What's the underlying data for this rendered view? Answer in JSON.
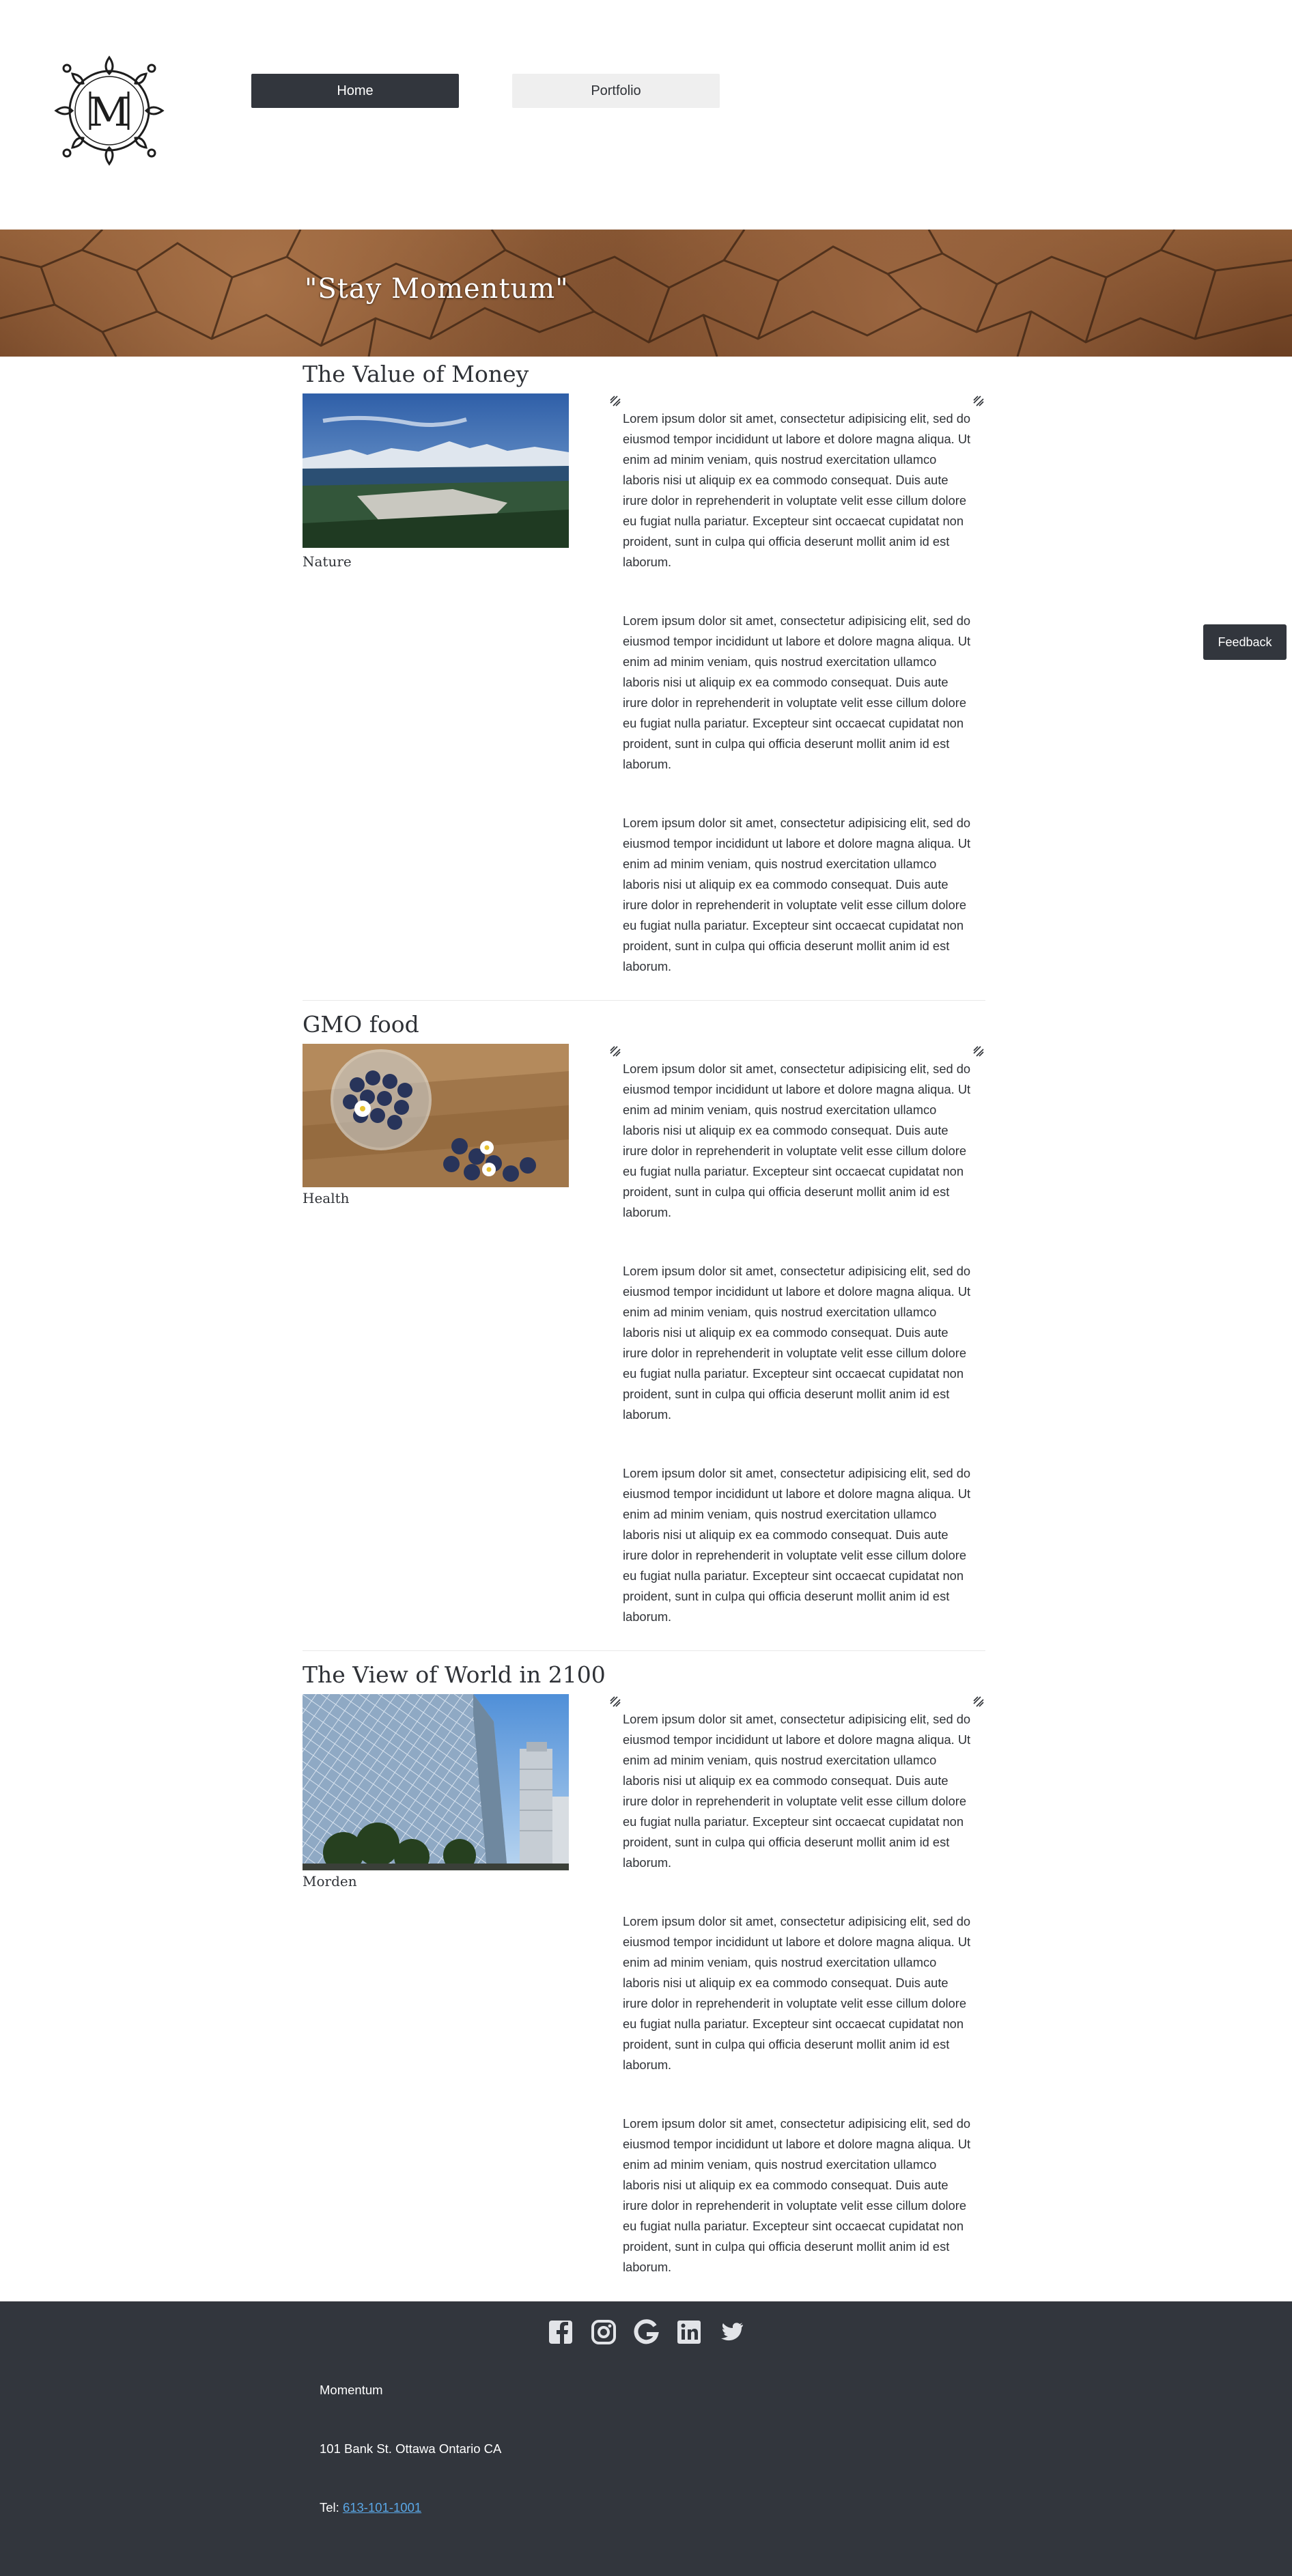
{
  "nav": {
    "home": "Home",
    "portfolio": "Portfolio"
  },
  "logo": {
    "letter": "M"
  },
  "hero": {
    "title": "\"Stay Momentum\""
  },
  "feedback": "Feedback",
  "lorem": "Lorem ipsum dolor sit amet, consectetur adipisicing elit, sed do eiusmod tempor incididunt ut labore et dolore magna aliqua. Ut enim ad minim veniam, quis nostrud exercitation ullamco laboris nisi ut aliquip ex ea commodo consequat. Duis aute irure dolor in reprehenderit in voluptate velit esse cillum dolore eu fugiat nulla pariatur. Excepteur sint occaecat cupidatat non proident, sunt in culpa qui officia deserunt mollit anim id est laborum.",
  "articles": [
    {
      "title": "The Value of Money",
      "category": "Nature",
      "image": "mountain-landscape"
    },
    {
      "title": "GMO food",
      "category": "Health",
      "image": "blueberries"
    },
    {
      "title": "The View of World in 2100",
      "category": "Morden",
      "image": "glass-building"
    }
  ],
  "footer": {
    "social": [
      "facebook-icon",
      "instagram-icon",
      "google-icon",
      "linkedin-icon",
      "twitter-icon"
    ],
    "company": "Momentum",
    "address": "101 Bank St. Ottawa Ontario CA",
    "tel_label": "Tel: ",
    "tel": "613-101-1001"
  },
  "colors": {
    "dark": "#32363d",
    "light_button": "#efefef",
    "link": "#5aa7e6"
  }
}
